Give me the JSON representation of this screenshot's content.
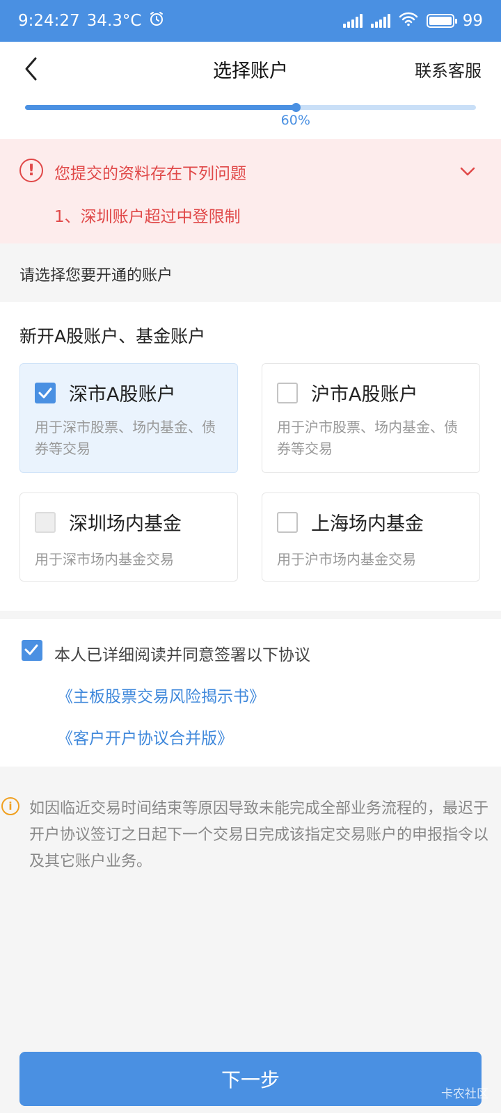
{
  "status_bar": {
    "time": "9:24:27",
    "temperature": "34.3°C",
    "battery": "99"
  },
  "header": {
    "title": "选择账户",
    "service": "联系客服"
  },
  "progress": {
    "percent": 60,
    "label": "60%"
  },
  "error": {
    "title": "您提交的资料存在下列问题",
    "items": [
      "1、深圳账户超过中登限制"
    ]
  },
  "select_hint": "请选择您要开通的账户",
  "accounts": {
    "title": "新开A股账户、基金账户",
    "options": [
      {
        "name": "深市A股账户",
        "desc": "用于深市股票、场内基金、债券等交易",
        "state": "checked"
      },
      {
        "name": "沪市A股账户",
        "desc": "用于沪市股票、场内基金、债券等交易",
        "state": "unchecked"
      },
      {
        "name": "深圳场内基金",
        "desc": "用于深市场内基金交易",
        "state": "disabled"
      },
      {
        "name": "上海场内基金",
        "desc": "用于沪市场内基金交易",
        "state": "unchecked"
      }
    ]
  },
  "agreement": {
    "checked": true,
    "text": "本人已详细阅读并同意签署以下协议",
    "links": [
      "《主板股票交易风险揭示书》",
      "《客户开户协议合并版》"
    ]
  },
  "notice": "如因临近交易时间结束等原因导致未能完成全部业务流程的，最迟于开户协议签订之日起下一个交易日完成该指定交易账户的申报指令以及其它账户业务。",
  "next_button": "下一步",
  "watermark": "卡农社区",
  "colors": {
    "primary": "#4a90e2",
    "error": "#e04848",
    "warning": "#f0a020"
  }
}
